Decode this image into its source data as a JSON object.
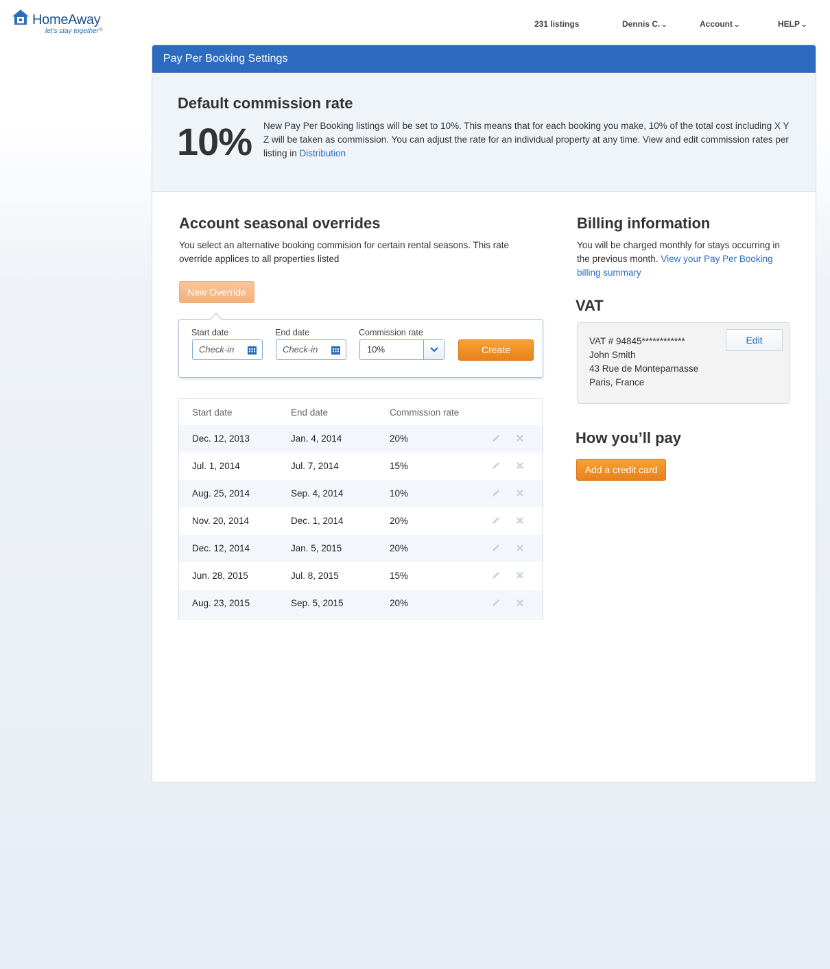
{
  "header": {
    "logo": {
      "brand_home": "Home",
      "brand_away": "Away",
      "tagline": "let's stay together",
      "tm": "®"
    },
    "nav": [
      {
        "label": "231 listings",
        "has_dropdown": false
      },
      {
        "label": "Dennis C.",
        "has_dropdown": true
      },
      {
        "label": "Account",
        "has_dropdown": true
      },
      {
        "label": "HELP",
        "has_dropdown": true
      }
    ]
  },
  "panel": {
    "title": "Pay Per Booking Settings"
  },
  "default_rate": {
    "heading": "Default commission rate",
    "rate": "10%",
    "description": "New Pay Per Booking listings will be set to 10%. This means that for each booking you make, 10% of the total cost including X Y Z will be taken as commission. You can adjust the rate for an individual property at any time. View and edit commission rates per listing in ",
    "link_text": "Distribution"
  },
  "overrides": {
    "heading": "Account seasonal overrides",
    "description": "You select an alternative booking commision for certain rental seasons. This rate override applices to all properties listed",
    "new_button": "New Override",
    "form": {
      "start_label": "Start date",
      "start_placeholder": "Check-in",
      "end_label": "End date",
      "end_placeholder": "Check-in",
      "rate_label": "Commission rate",
      "rate_value": "10%",
      "create_button": "Create"
    },
    "table": {
      "columns": [
        "Start date",
        "End date",
        "Commission rate"
      ],
      "rows": [
        {
          "start": "Dec. 12, 2013",
          "end": "Jan. 4, 2014",
          "rate": "20%"
        },
        {
          "start": "Jul. 1, 2014",
          "end": "Jul. 7, 2014",
          "rate": "15%"
        },
        {
          "start": "Aug. 25, 2014",
          "end": "Sep. 4, 2014",
          "rate": "10%"
        },
        {
          "start": "Nov. 20, 2014",
          "end": "Dec. 1, 2014",
          "rate": "20%"
        },
        {
          "start": "Dec. 12, 2014",
          "end": "Jan. 5, 2015",
          "rate": "20%"
        },
        {
          "start": "Jun. 28, 2015",
          "end": "Jul. 8, 2015",
          "rate": "15%"
        },
        {
          "start": "Aug. 23, 2015",
          "end": "Sep. 5, 2015",
          "rate": "20%"
        }
      ]
    }
  },
  "billing": {
    "heading": "Billing information",
    "description": "You will be charged monthly for stays occurring in the previous month. ",
    "link_text": "View your Pay Per Booking billing summary",
    "vat_heading": "VAT",
    "vat_number": "VAT # 94845************",
    "name": "John Smith",
    "address_line1": "43 Rue de Monteparnasse",
    "address_line2": "Paris, France",
    "edit_button": "Edit",
    "pay_heading": "How you’ll pay",
    "add_card_button": "Add a credit card"
  },
  "colors": {
    "header_blue": "#2c6bbf",
    "link_blue": "#2a6ebb",
    "orange": "#ee8a22"
  }
}
